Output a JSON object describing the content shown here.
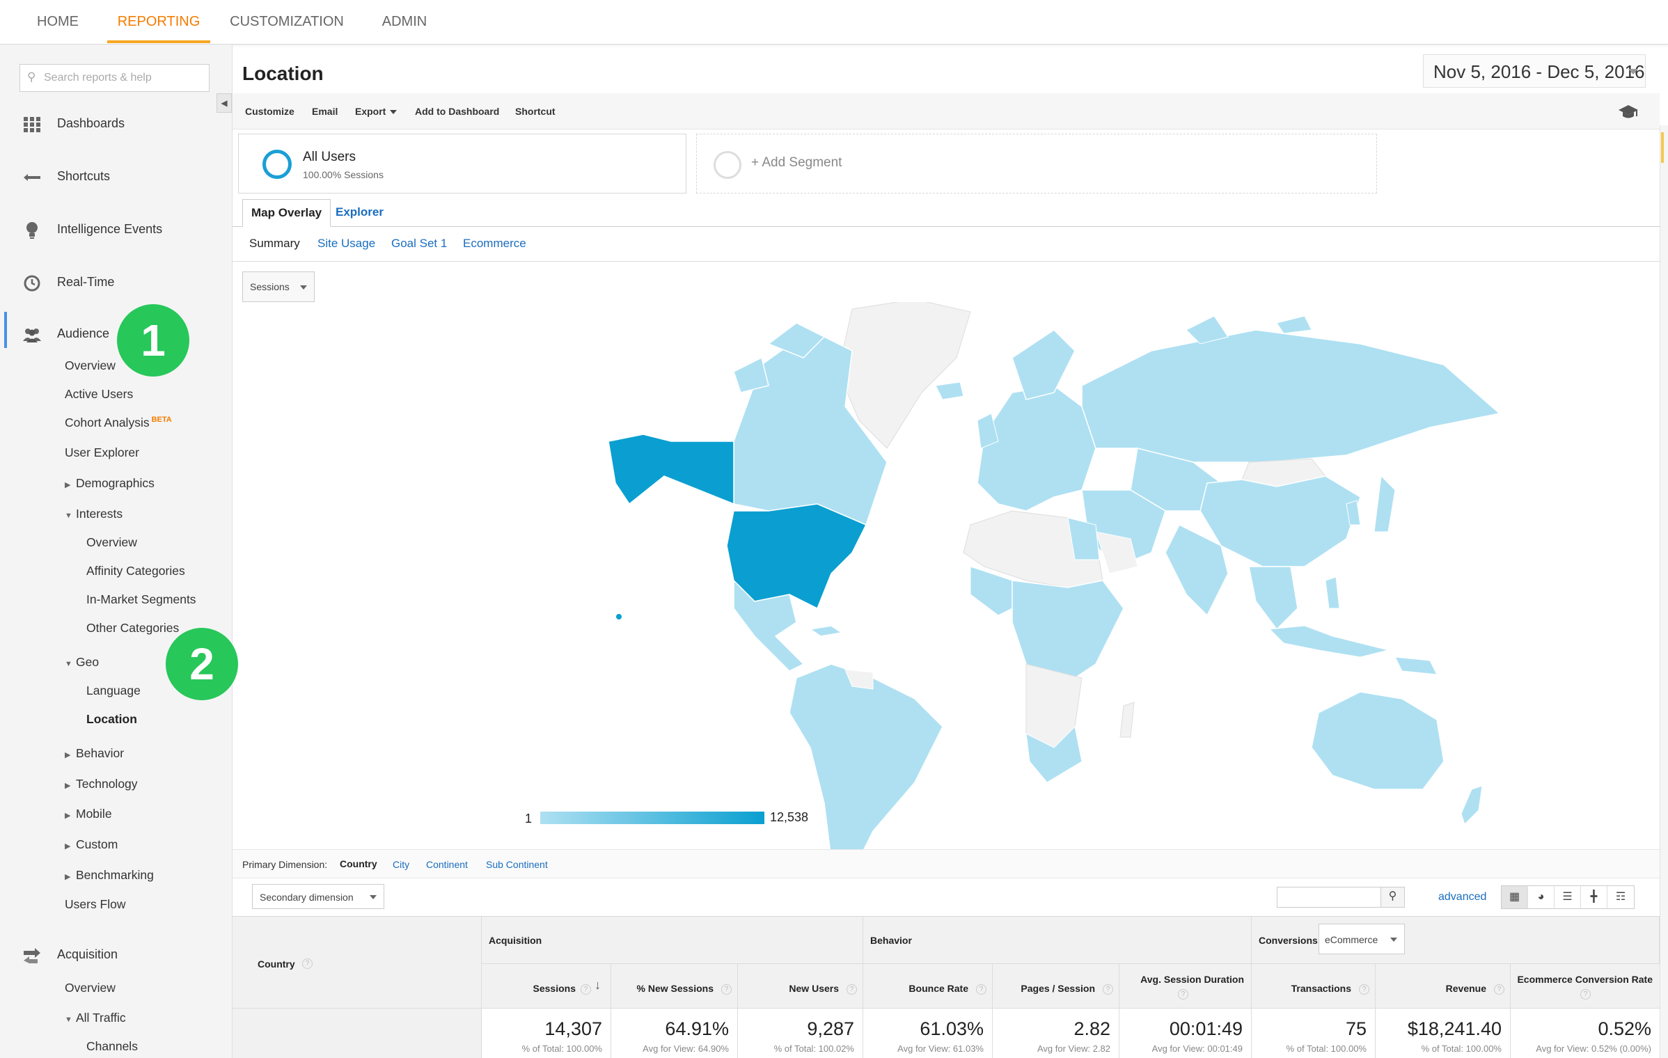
{
  "top_nav": {
    "items": [
      {
        "label": "HOME",
        "active": false
      },
      {
        "label": "REPORTING",
        "active": true
      },
      {
        "label": "CUSTOMIZATION",
        "active": false
      },
      {
        "label": "ADMIN",
        "active": false
      }
    ],
    "accent_color": "#f57c00"
  },
  "sidebar": {
    "search_placeholder": "Search reports & help",
    "main_items": [
      {
        "label": "Dashboards",
        "icon": "grid-icon"
      },
      {
        "label": "Shortcuts",
        "icon": "shortcut-arrows-icon"
      },
      {
        "label": "Intelligence Events",
        "icon": "lightbulb-icon"
      },
      {
        "label": "Real-Time",
        "icon": "clock-icon"
      },
      {
        "label": "Audience",
        "icon": "people-icon"
      }
    ],
    "audience": {
      "overview": "Overview",
      "active_users": "Active Users",
      "cohort_analysis": "Cohort Analysis",
      "cohort_badge": "BETA",
      "user_explorer": "User Explorer",
      "demographics": "Demographics",
      "interests": "Interests",
      "interests_children": [
        "Overview",
        "Affinity Categories",
        "In-Market Segments",
        "Other Categories"
      ],
      "geo": "Geo",
      "geo_children": [
        "Language",
        "Location"
      ],
      "behavior": "Behavior",
      "technology": "Technology",
      "mobile": "Mobile",
      "custom": "Custom",
      "benchmarking": "Benchmarking",
      "users_flow": "Users Flow"
    },
    "acquisition": {
      "label": "Acquisition",
      "icon": "acquisition-arrows-icon",
      "overview": "Overview",
      "all_traffic": "All Traffic",
      "channels": "Channels"
    }
  },
  "badges": [
    "1",
    "2"
  ],
  "page": {
    "title": "Location",
    "date_range": "Nov 5, 2016 - Dec 5, 2016",
    "toolbar": [
      "Customize",
      "Email",
      "Export",
      "Add to Dashboard",
      "Shortcut"
    ],
    "toolbar_icon": "graduation-cap-icon"
  },
  "segments": {
    "all_users_title": "All Users",
    "all_users_sub": "100.00% Sessions",
    "add_segment": "+ Add Segment"
  },
  "tabs": [
    "Map Overlay",
    "Explorer"
  ],
  "subtabs": [
    "Summary",
    "Site Usage",
    "Goal Set 1",
    "Ecommerce"
  ],
  "map": {
    "metric": "Sessions",
    "legend_min": "1",
    "legend_max": "12,538",
    "color_low": "#aee0f2",
    "color_high": "#0a9fd0",
    "color_none": "#f2f2f2"
  },
  "dimensions": {
    "label": "Primary Dimension:",
    "current": "Country",
    "options": [
      "City",
      "Continent",
      "Sub Continent"
    ]
  },
  "table_controls": {
    "secondary_dimension": "Secondary dimension",
    "advanced": "advanced",
    "search_value": ""
  },
  "table": {
    "country_header": "Country",
    "groups": [
      "Acquisition",
      "Behavior",
      "Conversions"
    ],
    "conversions_select": "eCommerce",
    "columns": [
      {
        "label": "Sessions",
        "total": "14,307",
        "sub": "% of Total: 100.00%"
      },
      {
        "label": "% New Sessions",
        "total": "64.91%",
        "sub": "Avg for View: 64.90%"
      },
      {
        "label": "New Users",
        "total": "9,287",
        "sub": "% of Total: 100.02%"
      },
      {
        "label": "Bounce Rate",
        "total": "61.03%",
        "sub": "Avg for View: 61.03%"
      },
      {
        "label": "Pages / Session",
        "total": "2.82",
        "sub": "Avg for View: 2.82"
      },
      {
        "label": "Avg. Session Duration",
        "total": "00:01:49",
        "sub": "Avg for View: 00:01:49"
      },
      {
        "label": "Transactions",
        "total": "75",
        "sub": "% of Total: 100.00%"
      },
      {
        "label": "Revenue",
        "total": "$18,241.40",
        "sub": "% of Total: 100.00%"
      },
      {
        "label": "Ecommerce Conversion Rate",
        "total": "0.52%",
        "sub": "Avg for View: 0.52% (0.00%)"
      }
    ]
  }
}
